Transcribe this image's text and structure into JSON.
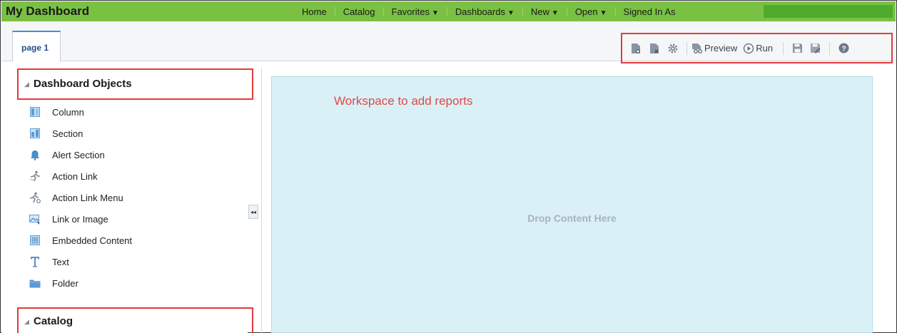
{
  "app": {
    "title": "My Dashboard"
  },
  "nav": {
    "items": [
      {
        "label": "Home",
        "dropdown": false
      },
      {
        "label": "Catalog",
        "dropdown": false
      },
      {
        "label": "Favorites",
        "dropdown": true
      },
      {
        "label": "Dashboards",
        "dropdown": true
      },
      {
        "label": "New",
        "dropdown": true
      },
      {
        "label": "Open",
        "dropdown": true
      },
      {
        "label": "Signed In As",
        "dropdown": false
      }
    ],
    "caret": "▼"
  },
  "tabs": [
    {
      "label": "page 1",
      "active": true
    }
  ],
  "toolbar": {
    "icons": [
      "add-page-icon",
      "delete-page-icon",
      "settings-icon"
    ],
    "preview_label": "Preview",
    "run_label": "Run",
    "save_icon": "save-icon",
    "save_as_icon": "save-as-icon",
    "help_icon": "help-icon"
  },
  "left_panel": {
    "dashboard_objects_title": "Dashboard Objects",
    "catalog_title": "Catalog",
    "objects": [
      {
        "label": "Column",
        "icon": "column-icon"
      },
      {
        "label": "Section",
        "icon": "section-icon"
      },
      {
        "label": "Alert Section",
        "icon": "bell-icon"
      },
      {
        "label": "Action Link",
        "icon": "action-link-icon"
      },
      {
        "label": "Action Link Menu",
        "icon": "action-link-menu-icon"
      },
      {
        "label": "Link or Image",
        "icon": "image-icon"
      },
      {
        "label": "Embedded Content",
        "icon": "embedded-content-icon"
      },
      {
        "label": "Text",
        "icon": "text-icon"
      },
      {
        "label": "Folder",
        "icon": "folder-icon"
      }
    ]
  },
  "workspace": {
    "note": "Workspace to add reports",
    "drop_text": "Drop Content Here"
  },
  "colors": {
    "topbar": "#7ac143",
    "highlight_box": "#e23b3b",
    "workspace_bg": "#d9f0f6",
    "icon_blue": "#5b9bd5"
  }
}
